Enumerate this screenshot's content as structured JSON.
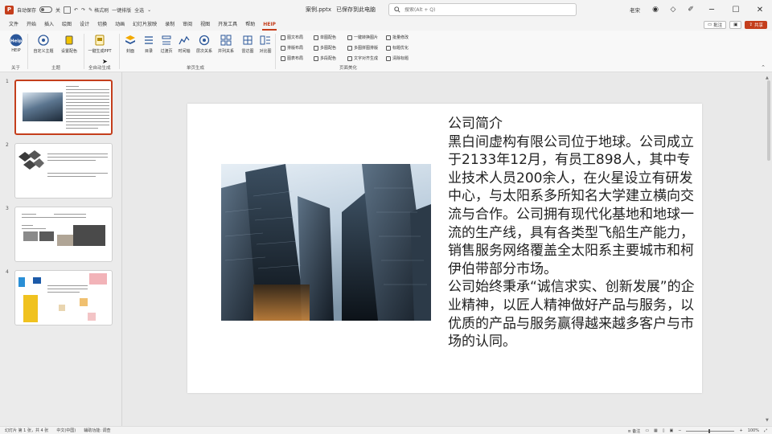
{
  "titlebar": {
    "autosave": "自动保存",
    "autosave_state": "关",
    "qa_format_brush": "格式刷",
    "qa_one_click_typeset": "一键排版",
    "qa_select": "全选",
    "filename": "案例.pptx",
    "filename_status": "已保存到此电脑",
    "search_placeholder": "搜索(Alt + Q)",
    "user": "老宋"
  },
  "menu": {
    "tabs": [
      "文件",
      "开始",
      "插入",
      "绘图",
      "设计",
      "切换",
      "动画",
      "幻灯片放映",
      "录制",
      "审阅",
      "视图",
      "开发工具",
      "帮助",
      "HEIP"
    ],
    "active_tab": "HEIP",
    "comment_btn": "批注",
    "share_btn": "共享"
  },
  "ribbon": {
    "buttons": {
      "heip": "HEIP",
      "custom_theme": "自定义主题",
      "set_color": "设置配色",
      "one_click_ppt": "一键生成PPT",
      "cover": "封面",
      "toc": "目录",
      "section": "过渡页",
      "timeline": "时间轴",
      "hierarchy": "层次关系",
      "parallel": "并列关系",
      "radar": "雷达图",
      "compare": "对比图"
    },
    "checks": [
      [
        "图文布局",
        "单图配色",
        "一键转换图片",
        "批量修改"
      ],
      [
        "排版布局",
        "多图配色",
        "多图拼图排版",
        "标题优化"
      ],
      [
        "图表布局",
        "多段配色",
        "文字对齐生成",
        "清除标题"
      ]
    ],
    "groups": {
      "about": "关于",
      "theme": "主题",
      "full_gen": "全自动生成",
      "single_gen": "单页生成",
      "beautify": "页面美化"
    }
  },
  "thumbnails": [
    "1",
    "2",
    "3",
    "4"
  ],
  "slide": {
    "title": "公司简介",
    "paragraph1": "黑白间虚构有限公司位于地球。公司成立于2133年12月，有员工898人，其中专业技术人员200余人，在火星设立有研发中心，与太阳系多所知名大学建立横向交流与合作。公司拥有现代化基地和地球一流的生产线，具有各类型飞船生产能力，销售服务网络覆盖全太阳系主要城市和柯伊伯带部分市场。",
    "paragraph2": "公司始终秉承“诚信求实、创新发展”的企业精神，以匠人精神做好产品与服务，以优质的产品与服务赢得越来越多客户与市场的认同。"
  },
  "status": {
    "slide_count": "幻灯片 第 1 张，共 4 张",
    "language": "中文(中国)",
    "accessibility": "辅助功能: 调查",
    "notes": "备注",
    "zoom": "100%"
  }
}
